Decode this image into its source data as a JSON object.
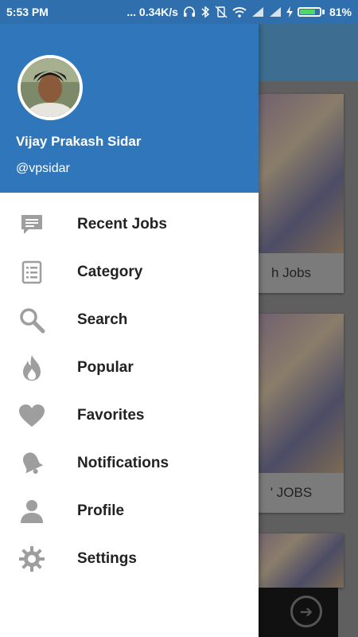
{
  "status_bar": {
    "time": "5:53 PM",
    "network_speed": "... 0.34K/s",
    "battery": "81%",
    "battery_level": 0.81
  },
  "drawer": {
    "user_name": "Vijay Prakash Sidar",
    "user_handle": "@vpsidar",
    "menu": [
      {
        "label": "Recent Jobs",
        "icon": "chat-icon"
      },
      {
        "label": "Category",
        "icon": "list-icon"
      },
      {
        "label": "Search",
        "icon": "search-icon"
      },
      {
        "label": "Popular",
        "icon": "flame-icon"
      },
      {
        "label": "Favorites",
        "icon": "heart-icon"
      },
      {
        "label": "Notifications",
        "icon": "bell-icon"
      },
      {
        "label": "Profile",
        "icon": "person-icon"
      },
      {
        "label": "Settings",
        "icon": "gear-icon"
      }
    ]
  },
  "background": {
    "cards": [
      {
        "caption": "h Jobs"
      },
      {
        "caption": "' JOBS"
      }
    ]
  },
  "colors": {
    "header_blue": "#2f77ba",
    "status_bar": "#2f6fad",
    "icon_gray": "#9e9e9e"
  }
}
